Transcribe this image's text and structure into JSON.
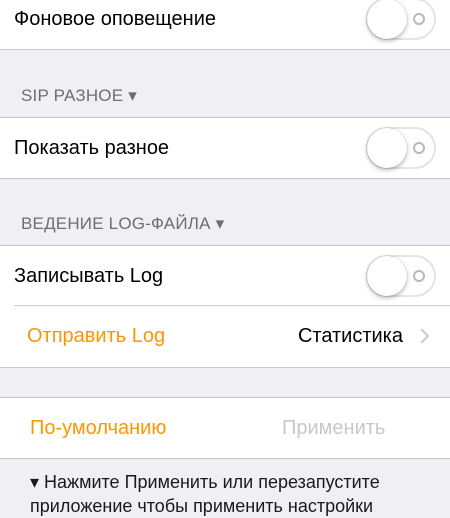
{
  "background_alert": {
    "label": "Фоновое оповещение",
    "switch_on": false
  },
  "sip_misc": {
    "header": "SIP РАЗНОЕ ▾",
    "show_misc_label": "Показать разное",
    "switch_on": false
  },
  "logging": {
    "header": "ВЕДЕНИЕ LOG-ФАЙЛА ▾",
    "write_log_label": "Записывать Log",
    "switch_on": false,
    "send_log_label": "Отправить Log",
    "statistics_label": "Статистика"
  },
  "actions": {
    "defaults_label": "По-умолчанию",
    "apply_label": "Применить"
  },
  "footer": {
    "note": "▾ Нажмите Применить или перезапустите приложение чтобы применить настройки"
  },
  "colors": {
    "accent": "#ff9500",
    "background": "#efeff4",
    "disabled": "#c7c7cc"
  }
}
